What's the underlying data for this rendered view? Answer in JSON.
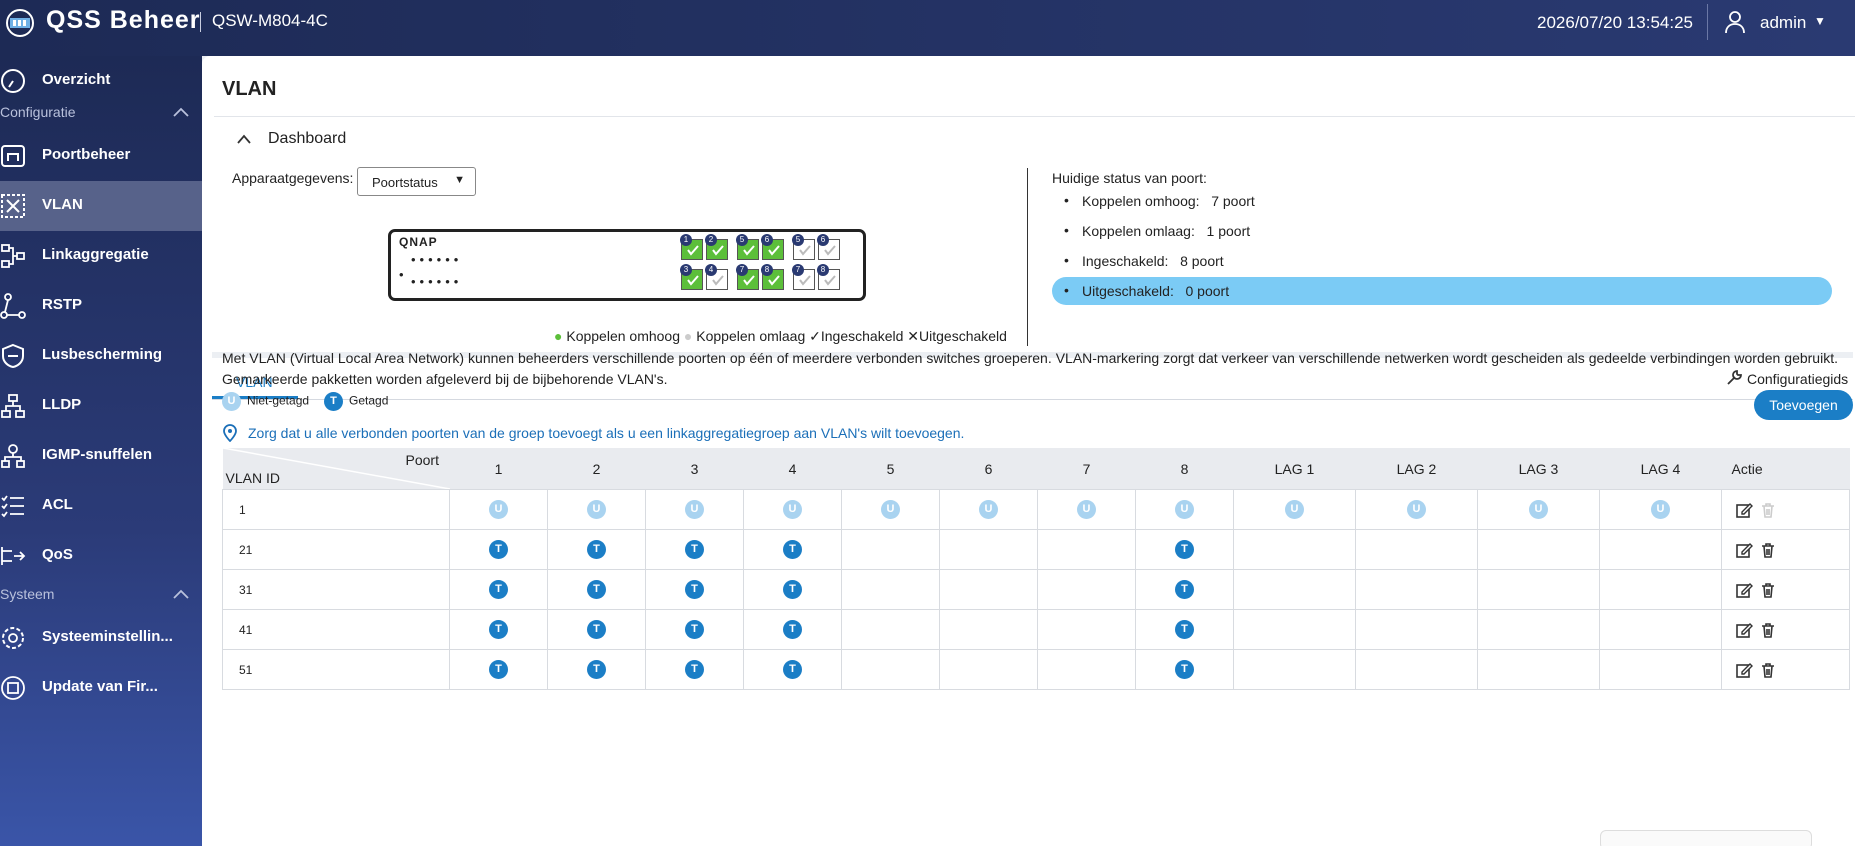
{
  "header": {
    "app_title": "QSS Beheer",
    "model": "QSW-M804-4C",
    "datetime": "2026/07/20  13:54:25",
    "user": "admin"
  },
  "sidebar": {
    "items": [
      {
        "label": "Overzicht",
        "icon": "gauge-icon"
      },
      {
        "label": "Poortbeheer",
        "icon": "port-icon"
      },
      {
        "label": "VLAN",
        "icon": "vlan-icon"
      },
      {
        "label": "Linkaggregatie",
        "icon": "link-aggregation-icon"
      },
      {
        "label": "RSTP",
        "icon": "rstp-icon"
      },
      {
        "label": "Lusbescherming",
        "icon": "shield-icon"
      },
      {
        "label": "LLDP",
        "icon": "topology-icon"
      },
      {
        "label": "IGMP-snuffelen",
        "icon": "igmp-icon"
      },
      {
        "label": "ACL",
        "icon": "list-icon"
      },
      {
        "label": "QoS",
        "icon": "qos-icon"
      },
      {
        "label": "Systeeminstellin...",
        "icon": "gear-icon"
      },
      {
        "label": "Update van Fir...",
        "icon": "firmware-icon"
      }
    ],
    "sections": {
      "config": "Configuratie",
      "system": "Systeem"
    },
    "active": "VLAN"
  },
  "page": {
    "title": "VLAN"
  },
  "dashboard": {
    "header": "Dashboard",
    "device_label": "Apparaatgegevens:",
    "select_value": "Poortstatus",
    "brand": "QNAP",
    "ports_top": [
      "1",
      "2",
      "5",
      "6",
      "5",
      "6"
    ],
    "ports_bottom": [
      "3",
      "4",
      "7",
      "8",
      "7",
      "8"
    ],
    "legend": {
      "up": "Koppelen omhoog",
      "down": "Koppelen omlaag",
      "enabled": "Ingeschakeld",
      "disabled": "Uitgeschakeld"
    },
    "status_title": "Huidige status van poort:",
    "status": [
      {
        "label": "Koppelen omhoog:",
        "value": "7  poort"
      },
      {
        "label": "Koppelen omlaag:",
        "value": "1  poort"
      },
      {
        "label": "Ingeschakeld:",
        "value": "8  poort"
      },
      {
        "label": "Uitgeschakeld:",
        "value": "0  poort"
      }
    ]
  },
  "vlan_tab": {
    "tab_label": "VLAN",
    "guide": "Configuratiegids",
    "description": "Met VLAN (Virtual Local Area Network) kunnen beheerders verschillende poorten op één of meerdere verbonden switches groeperen. VLAN-markering zorgt dat verkeer van verschillende netwerken wordt gescheiden als gedeelde verbindingen worden gebruikt. Gemarkeerde pakketten worden afgeleverd bij de bijbehorende VLAN's.",
    "untagged_label": "Niet-getagd",
    "tagged_label": "Getagd",
    "badge_u": "U",
    "badge_t": "T",
    "add_button": "Toevoegen",
    "info": "Zorg dat u alle verbonden poorten van de groep toevoegt als u een linkaggregatiegroep aan VLAN's wilt toevoegen."
  },
  "table": {
    "corner_top": "Poort",
    "corner_bottom": "VLAN  ID",
    "columns": [
      "1",
      "2",
      "3",
      "4",
      "5",
      "6",
      "7",
      "8",
      "LAG  1",
      "LAG  2",
      "LAG  3",
      "LAG  4"
    ],
    "action_header": "Actie",
    "rows": [
      {
        "id": "1",
        "cells": [
          "U",
          "U",
          "U",
          "U",
          "U",
          "U",
          "U",
          "U",
          "U",
          "U",
          "U",
          "U"
        ],
        "delete_enabled": false
      },
      {
        "id": "21",
        "cells": [
          "T",
          "T",
          "T",
          "T",
          "",
          "",
          "",
          "T",
          "",
          "",
          "",
          ""
        ],
        "delete_enabled": true
      },
      {
        "id": "31",
        "cells": [
          "T",
          "T",
          "T",
          "T",
          "",
          "",
          "",
          "T",
          "",
          "",
          "",
          ""
        ],
        "delete_enabled": true
      },
      {
        "id": "41",
        "cells": [
          "T",
          "T",
          "T",
          "T",
          "",
          "",
          "",
          "T",
          "",
          "",
          "",
          ""
        ],
        "delete_enabled": true
      },
      {
        "id": "51",
        "cells": [
          "T",
          "T",
          "T",
          "T",
          "",
          "",
          "",
          "T",
          "",
          "",
          "",
          ""
        ],
        "delete_enabled": true
      }
    ]
  },
  "colors": {
    "accent": "#1b7ec6",
    "link_up": "#5cbf3a",
    "highlight": "#7bcbf5",
    "sidebar": "#1d2a55"
  }
}
